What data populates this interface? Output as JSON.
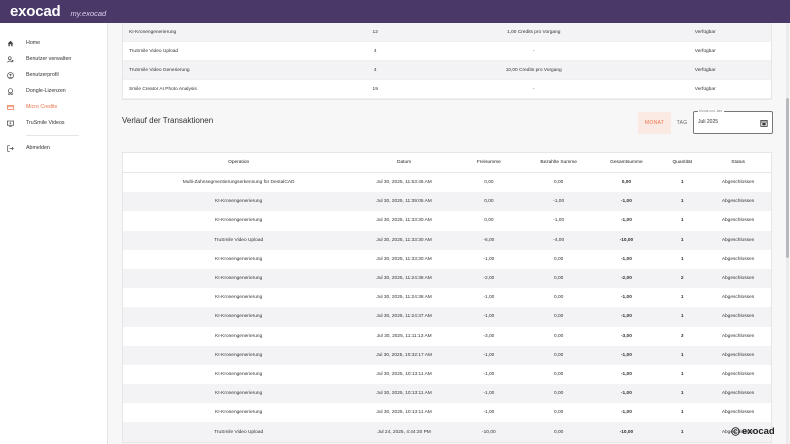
{
  "header": {
    "logo": "exocad",
    "sublogo": "my.exocad"
  },
  "sidebar": {
    "items": [
      {
        "label": "Home",
        "icon": "home-icon",
        "active": false
      },
      {
        "label": "Benutzer verwalten",
        "icon": "manage-users-icon",
        "active": false
      },
      {
        "label": "Benutzerprofil",
        "icon": "user-profile-icon",
        "active": false
      },
      {
        "label": "Dongle-Lizenzen",
        "icon": "dongle-icon",
        "active": false
      },
      {
        "label": "Micro Credits",
        "icon": "credit-card-icon",
        "active": true
      },
      {
        "label": "TruSmile Videos",
        "icon": "video-icon",
        "active": false
      }
    ],
    "logout": {
      "label": "Abmelden",
      "icon": "logout-icon"
    }
  },
  "top_table": {
    "rows": [
      {
        "name": "KI-Kronengenerierung",
        "qty": "12",
        "price": "1,00 Credits pro Vorgang",
        "status": "Verfügbar"
      },
      {
        "name": "TruSmile Video Upload",
        "qty": "4",
        "price": "-",
        "status": "Verfügbar"
      },
      {
        "name": "TruSmile Video Generierung",
        "qty": "4",
        "price": "10,00 Credits pro Vorgang",
        "status": "Verfügbar"
      },
      {
        "name": "Smile Creator AI Photo Analysis",
        "qty": "19",
        "price": "-",
        "status": "Verfügbar"
      }
    ]
  },
  "transactions": {
    "title": "Verlauf der Transaktionen",
    "toggle": {
      "month": "MONAT",
      "day": "TAG"
    },
    "month_field": {
      "label": "Monat und Jahr",
      "value": "Juli 2025"
    },
    "columns": [
      "Operation",
      "Datum",
      "Freisumme",
      "Bezahlte Summe",
      "Gesamtsumme",
      "Quantität",
      "Status"
    ],
    "rows": [
      {
        "op": "Multi-Zahnsegmentierungserkennung für DentalCAD",
        "date": "Jul 30, 2025, 11:53:46 AM",
        "free": "0,00",
        "paid": "0,00",
        "total": "0,00",
        "qty": "1",
        "status": "Abgeschlossen"
      },
      {
        "op": "KI-Kronengenerierung",
        "date": "Jul 30, 2025, 11:39:05 AM",
        "free": "0,00",
        "paid": "-1,00",
        "total": "-1,00",
        "qty": "1",
        "status": "Abgeschlossen"
      },
      {
        "op": "KI-Kronengenerierung",
        "date": "Jul 30, 2025, 11:33:30 AM",
        "free": "0,00",
        "paid": "-1,00",
        "total": "-1,00",
        "qty": "1",
        "status": "Abgeschlossen"
      },
      {
        "op": "TruSmile Video Upload",
        "date": "Jul 30, 2025, 11:33:30 AM",
        "free": "-6,00",
        "paid": "-4,00",
        "total": "-10,00",
        "qty": "1",
        "status": "Abgeschlossen"
      },
      {
        "op": "KI-Kronengenerierung",
        "date": "Jul 30, 2025, 11:33:30 AM",
        "free": "-1,00",
        "paid": "0,00",
        "total": "-1,00",
        "qty": "1",
        "status": "Abgeschlossen"
      },
      {
        "op": "KI-Kronengenerierung",
        "date": "Jul 30, 2025, 11:24:38 AM",
        "free": "-2,00",
        "paid": "0,00",
        "total": "-2,00",
        "qty": "2",
        "status": "Abgeschlossen"
      },
      {
        "op": "KI-Kronengenerierung",
        "date": "Jul 30, 2025, 11:24:38 AM",
        "free": "-1,00",
        "paid": "0,00",
        "total": "-1,00",
        "qty": "1",
        "status": "Abgeschlossen"
      },
      {
        "op": "KI-Kronengenerierung",
        "date": "Jul 30, 2025, 11:24:37 AM",
        "free": "-1,00",
        "paid": "0,00",
        "total": "-1,00",
        "qty": "1",
        "status": "Abgeschlossen"
      },
      {
        "op": "KI-Kronengenerierung",
        "date": "Jul 30, 2025, 11:11:13 AM",
        "free": "-3,00",
        "paid": "0,00",
        "total": "-3,00",
        "qty": "3",
        "status": "Abgeschlossen"
      },
      {
        "op": "KI-Kronengenerierung",
        "date": "Jul 30, 2025, 10:32:17 AM",
        "free": "-1,00",
        "paid": "0,00",
        "total": "-1,00",
        "qty": "1",
        "status": "Abgeschlossen"
      },
      {
        "op": "KI-Kronengenerierung",
        "date": "Jul 30, 2025, 10:13:11 AM",
        "free": "-1,00",
        "paid": "0,00",
        "total": "-1,00",
        "qty": "1",
        "status": "Abgeschlossen"
      },
      {
        "op": "KI-Kronengenerierung",
        "date": "Jul 30, 2025, 10:13:11 AM",
        "free": "-1,00",
        "paid": "0,00",
        "total": "-1,00",
        "qty": "1",
        "status": "Abgeschlossen"
      },
      {
        "op": "KI-Kronengenerierung",
        "date": "Jul 30, 2025, 10:13:11 AM",
        "free": "-1,00",
        "paid": "0,00",
        "total": "-1,00",
        "qty": "1",
        "status": "Abgeschlossen"
      },
      {
        "op": "TruSmile Video Upload",
        "date": "Jul 24, 2025, 4:44:30 PM",
        "free": "-10,00",
        "paid": "0,00",
        "total": "-10,00",
        "qty": "1",
        "status": "Abgeschlossen"
      }
    ]
  },
  "watermark": {
    "text": "exocad"
  },
  "colors": {
    "topbar": "#4a3868",
    "accent": "#e8734a",
    "active_bg": "#fbe9e3"
  }
}
